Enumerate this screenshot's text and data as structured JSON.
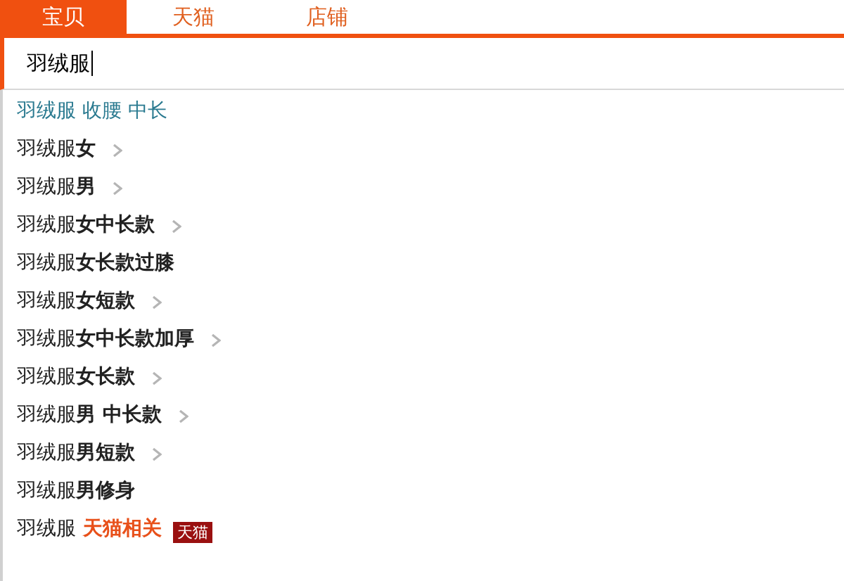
{
  "tabs": [
    {
      "label": "宝贝",
      "selected": true
    },
    {
      "label": "天猫",
      "selected": false
    },
    {
      "label": "店铺",
      "selected": false
    }
  ],
  "search": {
    "value": "羽绒服"
  },
  "suggestions": [
    {
      "kind": "related",
      "text": "羽绒服 收腰 中长"
    },
    {
      "kind": "plain",
      "prefix": "羽绒服",
      "suffix": "女",
      "expandable": true
    },
    {
      "kind": "plain",
      "prefix": "羽绒服",
      "suffix": "男",
      "expandable": true
    },
    {
      "kind": "plain",
      "prefix": "羽绒服",
      "suffix": "女中长款",
      "expandable": true
    },
    {
      "kind": "plain",
      "prefix": "羽绒服",
      "suffix": "女长款过膝",
      "expandable": false
    },
    {
      "kind": "plain",
      "prefix": "羽绒服",
      "suffix": "女短款",
      "expandable": true
    },
    {
      "kind": "plain",
      "prefix": "羽绒服",
      "suffix": "女中长款加厚",
      "expandable": true
    },
    {
      "kind": "plain",
      "prefix": "羽绒服",
      "suffix": "女长款",
      "expandable": true
    },
    {
      "kind": "plain",
      "prefix": "羽绒服",
      "suffix": "男 中长款",
      "expandable": true
    },
    {
      "kind": "plain",
      "prefix": "羽绒服",
      "suffix": "男短款",
      "expandable": true
    },
    {
      "kind": "plain",
      "prefix": "羽绒服",
      "suffix": "男修身",
      "expandable": false
    },
    {
      "kind": "tmall",
      "prefix": "羽绒服",
      "suffix": "天猫相关",
      "badge": "天猫"
    }
  ]
}
